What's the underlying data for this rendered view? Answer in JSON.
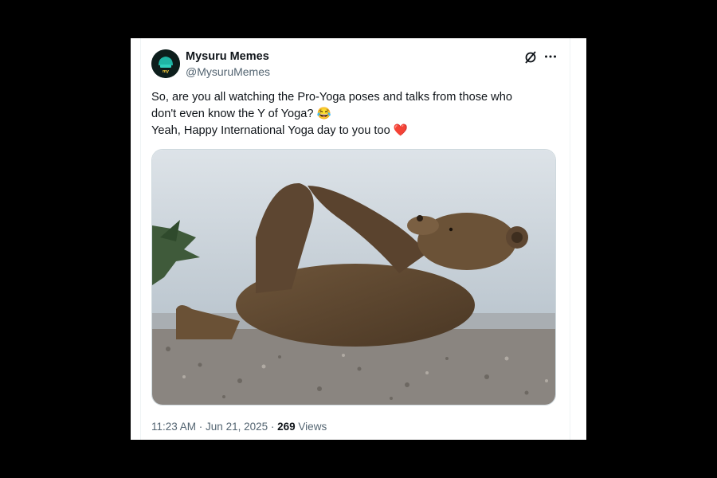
{
  "tweet": {
    "author": {
      "display_name": "Mysuru Memes",
      "handle": "@MysuruMemes",
      "avatar_text": "my Mysuru memes"
    },
    "text_lines": [
      "So, are you all watching the Pro-Yoga poses and talks from those who",
      "don't even know the Y of Yoga? 😂",
      "Yeah, Happy International Yoga day to you too ❤️"
    ],
    "image": {
      "subject": "brown bear lying on its back holding its hind feet on a pebble beach"
    },
    "time": "11:23 AM",
    "separator": " · ",
    "date": "Jun 21, 2025",
    "views_count": "269",
    "views_label": "Views"
  },
  "icons": {
    "grok": "grok-icon",
    "more": "more-icon"
  },
  "colors": {
    "text_primary": "#0f1419",
    "text_secondary": "#536471",
    "background": "#ffffff",
    "frame": "#000000"
  }
}
